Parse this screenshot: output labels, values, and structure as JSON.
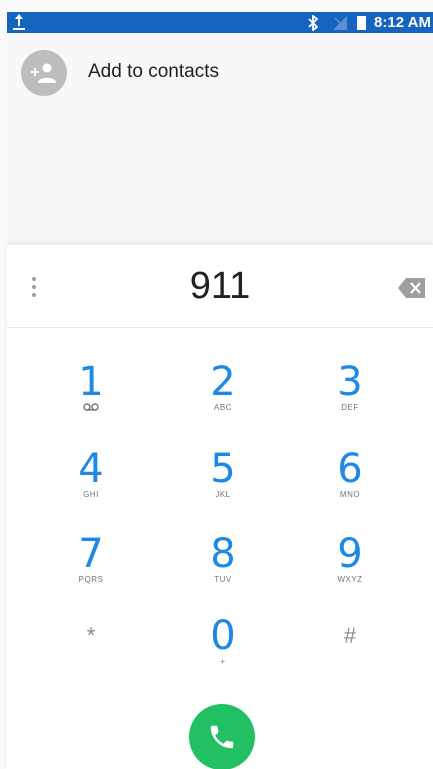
{
  "status_bar": {
    "time": "8:12 AM",
    "icons": [
      "upload-icon",
      "bluetooth-icon",
      "no-signal-icon",
      "battery-icon"
    ],
    "background": "#1565c0"
  },
  "add_contact": {
    "label": "Add to contacts",
    "icon": "add-person-icon"
  },
  "dialer": {
    "digits": "911",
    "menu_icon": "overflow-menu-icon",
    "delete_icon": "backspace-icon",
    "keys": [
      {
        "num": "1",
        "letters": "",
        "icon": "voicemail-icon"
      },
      {
        "num": "2",
        "letters": "ABC"
      },
      {
        "num": "3",
        "letters": "DEF"
      },
      {
        "num": "4",
        "letters": "GHI"
      },
      {
        "num": "5",
        "letters": "JKL"
      },
      {
        "num": "6",
        "letters": "MNO"
      },
      {
        "num": "7",
        "letters": "PQRS"
      },
      {
        "num": "8",
        "letters": "TUV"
      },
      {
        "num": "9",
        "letters": "WXYZ"
      },
      {
        "num": "*",
        "letters": ""
      },
      {
        "num": "0",
        "letters": "+"
      },
      {
        "num": "#",
        "letters": ""
      }
    ],
    "call_icon": "phone-icon",
    "accent_color": "#1e88e5",
    "call_color": "#21c062"
  }
}
